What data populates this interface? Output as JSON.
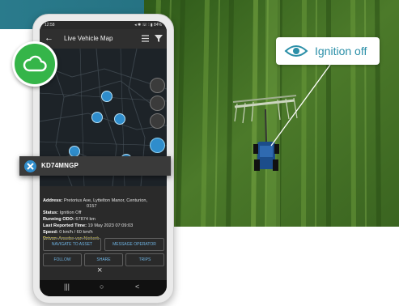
{
  "background": {
    "teal": "#2a7b8c",
    "field": "#3f6a22"
  },
  "ignition_badge": {
    "label": "Ignition off",
    "icon": "eye-icon",
    "color": "#2b8fa8"
  },
  "cloud_badge": {
    "icon": "cloud-sync-icon",
    "color": "#35b549"
  },
  "phone": {
    "status_bar": {
      "time": "12:58",
      "right": "◂ ✱ ☏ ⫶ ▮ 84%"
    },
    "app_bar": {
      "back_icon": "back-arrow-icon",
      "title": "Live Vehicle Map",
      "icons": [
        "list-icon",
        "filter-icon"
      ]
    },
    "map": {
      "controls": [
        "layers-icon",
        "satellite-icon",
        "zoom-icon",
        "menu-icon"
      ],
      "labels": [
        "KD74MNGP"
      ]
    },
    "vehicle": {
      "id": "KD74MNGP",
      "icon": "close-x-icon"
    },
    "details": [
      {
        "label": "Address:",
        "value": "Pretorius Ave, Lyttelton Manor, Centurion,",
        "cont": "0157"
      },
      {
        "label": "Status:",
        "value": "Ignition Off"
      },
      {
        "label": "Running ODO:",
        "value": "67874 km"
      },
      {
        "label": "Last Reported Time:",
        "value": "19 May 2023 07:09:03"
      },
      {
        "label": "Speed:",
        "value": "0 km/h / 60 km/h"
      },
      {
        "label": "Driver:",
        "value": "Ansebe van Niekerk"
      }
    ],
    "actions": {
      "navigate": "NAVIGATE TO ASSET",
      "message": "MESSAGE OPERATOR",
      "follow": "FOLLOW",
      "share": "SHARE",
      "trips": "TRIPS"
    },
    "close": "×",
    "nav": {
      "recent": "|||",
      "home": "○",
      "back": "<"
    }
  }
}
